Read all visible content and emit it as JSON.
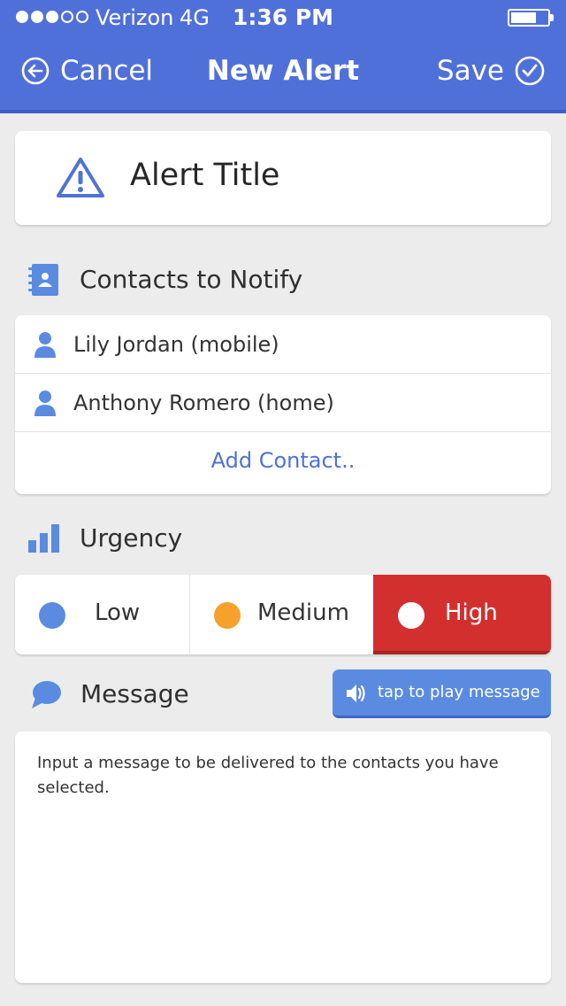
{
  "status_bar": {
    "carrier": "Verizon",
    "network": "4G",
    "time": "1:36 PM",
    "signal_bars_filled": 3,
    "signal_bars_total": 5,
    "battery_level": 0.7
  },
  "nav": {
    "cancel_label": "Cancel",
    "title": "New Alert",
    "save_label": "Save"
  },
  "alert": {
    "title": "Alert Title"
  },
  "contacts": {
    "heading": "Contacts to Notify",
    "items": [
      {
        "label": "Lily Jordan  (mobile)"
      },
      {
        "label": "Anthony Romero  (home)"
      }
    ],
    "add_label": "Add Contact.."
  },
  "urgency": {
    "heading": "Urgency",
    "options": [
      {
        "label": "Low",
        "color": "#5b8be0"
      },
      {
        "label": "Medium",
        "color": "#f5a12b"
      },
      {
        "label": "High",
        "color": "#d32f2f"
      }
    ],
    "selected": "High"
  },
  "message": {
    "heading": "Message",
    "play_label": "tap to play message",
    "text": "Input a message to be delivered to the contacts you have selected."
  },
  "colors": {
    "accent": "#5070d9",
    "link": "#4f72d6",
    "high": "#d32f2f",
    "background": "#ececec"
  }
}
